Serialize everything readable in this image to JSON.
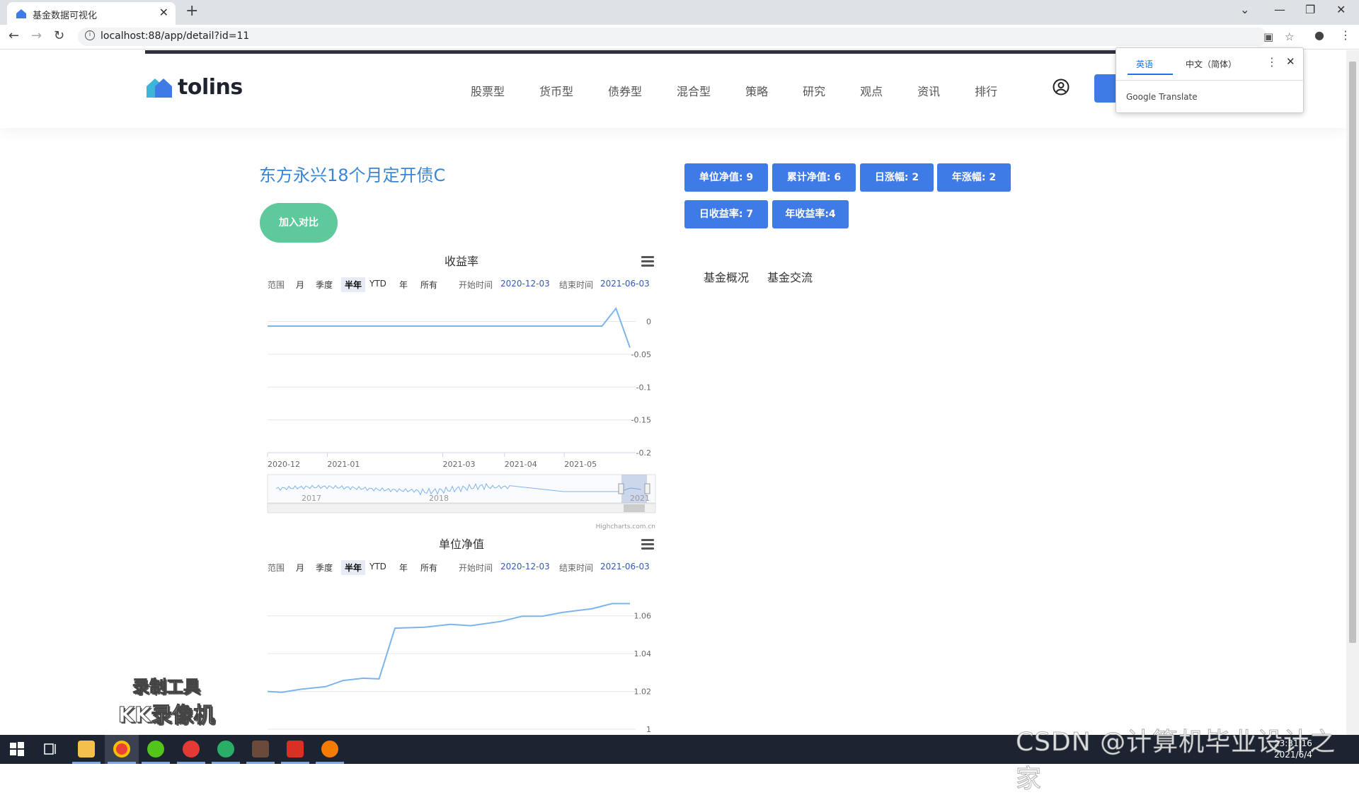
{
  "browser": {
    "tab_title": "基金数据可视化",
    "url": "localhost:88/app/detail?id=11"
  },
  "site": {
    "logo": "tolins",
    "nav": [
      "股票型",
      "货币型",
      "债券型",
      "混合型",
      "策略",
      "研究",
      "观点",
      "资讯",
      "排行"
    ]
  },
  "fund": {
    "title": "东方永兴18个月定开债C",
    "compare_button": "加入对比",
    "stats_row1": [
      "单位净值: 9",
      "累计净值: 6",
      "日涨幅: 2",
      "年涨幅: 2"
    ],
    "stats_row2": [
      "日收益率: 7",
      "年收益率:4"
    ],
    "tabs": [
      "基金概况",
      "基金交流"
    ]
  },
  "range_selector": {
    "label": "范围",
    "buttons": [
      "月",
      "季度",
      "半年",
      "YTD",
      "年",
      "所有"
    ],
    "selected": "半年",
    "start_label": "开始时间",
    "start_date": "2020-12-03",
    "end_label": "结束时间",
    "end_date": "2021-06-03"
  },
  "chart_data": [
    {
      "type": "line",
      "title": "收益率",
      "x_ticks": [
        "2020-12",
        "2021-01",
        "2021-03",
        "2021-04",
        "2021-05"
      ],
      "y_ticks": [
        "0",
        "-0.05",
        "-0.1",
        "-0.15",
        "-0.2"
      ],
      "ylim": [
        -0.2,
        0.02
      ],
      "series": [
        {
          "values": [
            {
              "x": "2020-12-03",
              "y": -0.007
            },
            {
              "x": "2021-05-20",
              "y": -0.007
            },
            {
              "x": "2021-05-27",
              "y": 0.02
            },
            {
              "x": "2021-06-03",
              "y": -0.04
            }
          ]
        }
      ],
      "navigator_labels": [
        "2017",
        "2018",
        "2021"
      ],
      "credit": "Highcharts.com.cn",
      "grid": true
    },
    {
      "type": "line",
      "title": "单位净值",
      "y_ticks": [
        "1.06",
        "1.04",
        "1.02",
        "1"
      ],
      "ylim": [
        1.0,
        1.07
      ],
      "series": [
        {
          "values": [
            {
              "x": "2020-12-03",
              "y": 1.02
            },
            {
              "x": "2020-12-10",
              "y": 1.0195
            },
            {
              "x": "2020-12-20",
              "y": 1.0212
            },
            {
              "x": "2021-01-01",
              "y": 1.0225
            },
            {
              "x": "2021-01-10",
              "y": 1.0258
            },
            {
              "x": "2021-01-20",
              "y": 1.027
            },
            {
              "x": "2021-01-28",
              "y": 1.0266
            },
            {
              "x": "2021-02-05",
              "y": 1.0535
            },
            {
              "x": "2021-02-20",
              "y": 1.054
            },
            {
              "x": "2021-03-05",
              "y": 1.0555
            },
            {
              "x": "2021-03-15",
              "y": 1.0548
            },
            {
              "x": "2021-03-30",
              "y": 1.057
            },
            {
              "x": "2021-04-10",
              "y": 1.0598
            },
            {
              "x": "2021-04-20",
              "y": 1.0598
            },
            {
              "x": "2021-04-30",
              "y": 1.0618
            },
            {
              "x": "2021-05-15",
              "y": 1.0638
            },
            {
              "x": "2021-05-25",
              "y": 1.0665
            },
            {
              "x": "2021-06-03",
              "y": 1.0665
            }
          ]
        }
      ],
      "grid": true
    }
  ],
  "translate_popup": {
    "lang_from": "英语",
    "lang_to": "中文（简体）",
    "brand": "Google Translate"
  },
  "watermark": {
    "line1": "录制工具",
    "line2": "KK录像机",
    "csdn": "CSDN @计算机毕业设计之家"
  },
  "taskbar": {
    "time": "23:31:16",
    "date": "2021/6/4"
  },
  "colors": {
    "accent_blue": "#3f7be6",
    "title_blue": "#3a86d4",
    "compare_green": "#5ec99a",
    "line_color": "#7cb5ec"
  }
}
